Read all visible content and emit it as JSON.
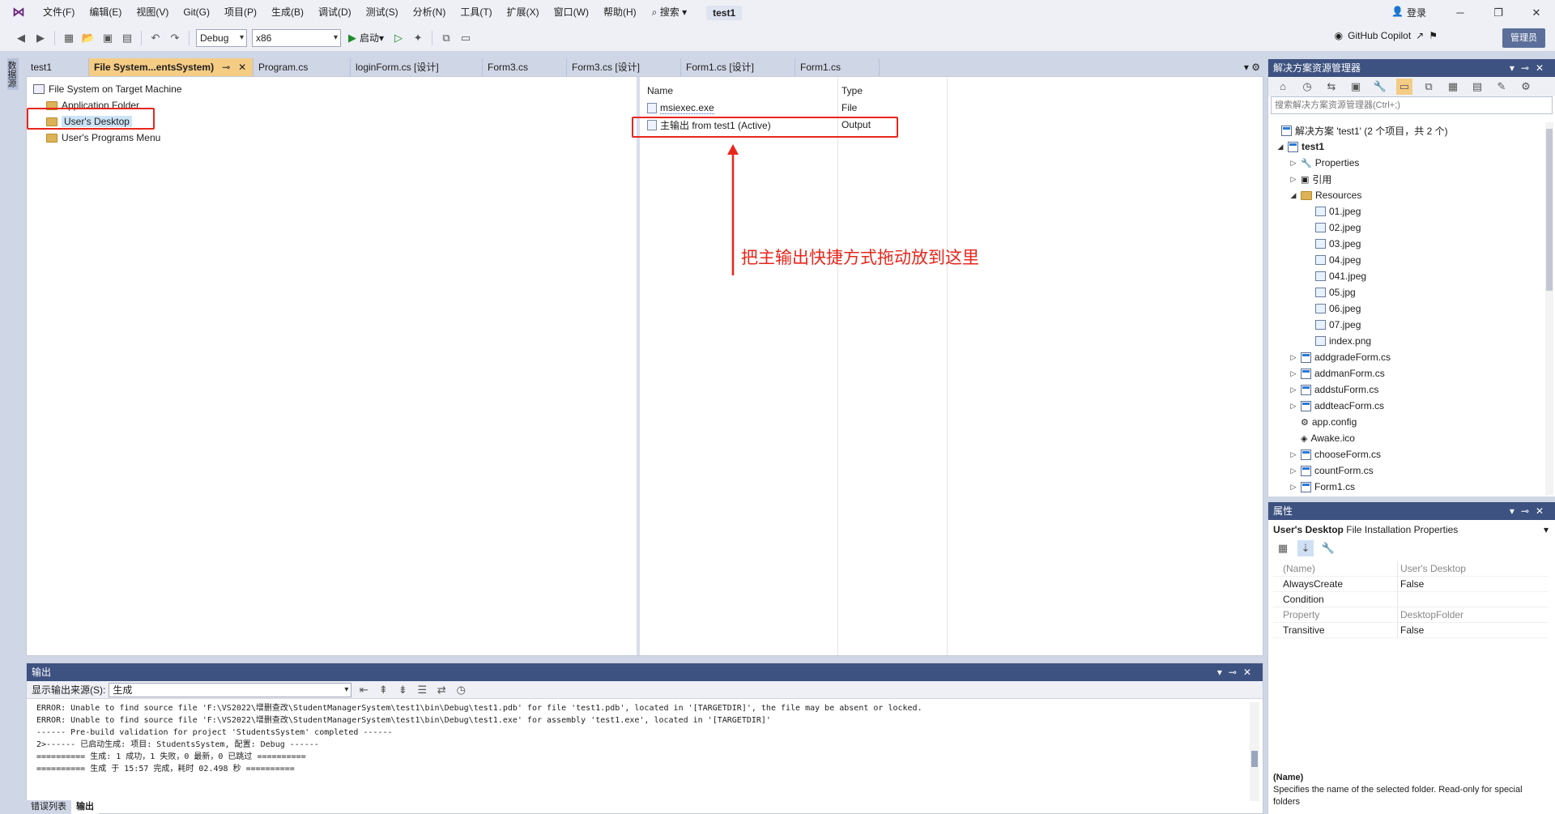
{
  "menu": {
    "items": [
      "文件(F)",
      "编辑(E)",
      "视图(V)",
      "Git(G)",
      "项目(P)",
      "生成(B)",
      "调试(D)",
      "测试(S)",
      "分析(N)",
      "工具(T)",
      "扩展(X)",
      "窗口(W)",
      "帮助(H)"
    ],
    "search_label": "搜索",
    "solution_name": "test1",
    "login_label": "登录"
  },
  "toolbar": {
    "config": "Debug",
    "platform": "x86",
    "start_label": "启动",
    "copilot_label": "GitHub Copilot",
    "admin_label": "管理员"
  },
  "left_strip": {
    "label": "数据源"
  },
  "tabs": [
    {
      "label": "test1"
    },
    {
      "label": "File System...entsSystem)"
    },
    {
      "label": "Program.cs"
    },
    {
      "label": "loginForm.cs [设计]"
    },
    {
      "label": "Form3.cs"
    },
    {
      "label": "Form3.cs [设计]"
    },
    {
      "label": "Form1.cs [设计]"
    },
    {
      "label": "Form1.cs"
    }
  ],
  "filesystem_tree": {
    "root": "File System on Target Machine",
    "folders": [
      "Application Folder",
      "User's Desktop",
      "User's Programs Menu"
    ]
  },
  "file_list": {
    "columns": [
      "Name",
      "Type"
    ],
    "rows": [
      {
        "name": "msiexec.exe",
        "type": "File"
      },
      {
        "name": "主输出 from test1 (Active)",
        "type": "Output"
      }
    ]
  },
  "annotation": "把主输出快捷方式拖动放到这里",
  "output_panel": {
    "title": "输出",
    "source_label": "显示输出来源(S):",
    "source_value": "生成",
    "lines": [
      "ERROR: Unable to find source file 'F:\\VS2022\\增删查改\\StudentManagerSystem\\test1\\bin\\Debug\\test1.pdb' for file 'test1.pdb', located in '[TARGETDIR]', the file may be absent or locked.",
      "ERROR: Unable to find source file 'F:\\VS2022\\增删查改\\StudentManagerSystem\\test1\\bin\\Debug\\test1.exe' for assembly 'test1.exe', located in '[TARGETDIR]'",
      "------ Pre-build validation for project 'StudentsSystem' completed ------",
      "2>------ 已启动生成: 项目: StudentsSystem, 配置: Debug ------",
      "========== 生成: 1 成功，1 失败，0 最新，0 已跳过 ==========",
      "========== 生成 于 15:57 完成，耗时 02.498 秒 =========="
    ],
    "bottom_tabs": [
      "错误列表",
      "输出"
    ]
  },
  "solution_explorer": {
    "title": "解决方案资源管理器",
    "search_placeholder": "搜索解决方案资源管理器(Ctrl+;)",
    "solution_label": "解决方案 'test1' (2 个项目，共 2 个)",
    "project": "test1",
    "nodes": [
      {
        "label": "Properties",
        "kind": "wrench",
        "expand": "▷"
      },
      {
        "label": "引用",
        "kind": "ref",
        "expand": "▷"
      },
      {
        "label": "Resources",
        "kind": "folder",
        "expand": "◢"
      },
      {
        "label": "01.jpeg",
        "kind": "image"
      },
      {
        "label": "02.jpeg",
        "kind": "image"
      },
      {
        "label": "03.jpeg",
        "kind": "image"
      },
      {
        "label": "04.jpeg",
        "kind": "image"
      },
      {
        "label": "041.jpeg",
        "kind": "image"
      },
      {
        "label": "05.jpg",
        "kind": "image"
      },
      {
        "label": "06.jpeg",
        "kind": "image"
      },
      {
        "label": "07.jpeg",
        "kind": "image"
      },
      {
        "label": "index.png",
        "kind": "image"
      },
      {
        "label": "addgradeForm.cs",
        "kind": "form",
        "expand": "▷"
      },
      {
        "label": "addmanForm.cs",
        "kind": "form",
        "expand": "▷"
      },
      {
        "label": "addstuForm.cs",
        "kind": "form",
        "expand": "▷"
      },
      {
        "label": "addteacForm.cs",
        "kind": "form",
        "expand": "▷"
      },
      {
        "label": "app.config",
        "kind": "config"
      },
      {
        "label": "Awake.ico",
        "kind": "icofile"
      },
      {
        "label": "chooseForm.cs",
        "kind": "form",
        "expand": "▷"
      },
      {
        "label": "countForm.cs",
        "kind": "form",
        "expand": "▷"
      },
      {
        "label": "Form1.cs",
        "kind": "form",
        "expand": "▷"
      }
    ]
  },
  "properties": {
    "title": "属性",
    "object_name": "User's Desktop",
    "object_type": "File Installation Properties",
    "rows": [
      {
        "name": "(Name)",
        "value": "User's Desktop"
      },
      {
        "name": "AlwaysCreate",
        "value": "False"
      },
      {
        "name": "Condition",
        "value": ""
      },
      {
        "name": "Property",
        "value": "DesktopFolder"
      },
      {
        "name": "Transitive",
        "value": "False"
      }
    ],
    "desc_title": "(Name)",
    "desc_text": "Specifies the name of the selected folder. Read-only for special folders"
  },
  "colors": {
    "accent_tab": "#f5cc84",
    "highlight_box": "#e8261c",
    "panel_header": "#3d5280"
  }
}
